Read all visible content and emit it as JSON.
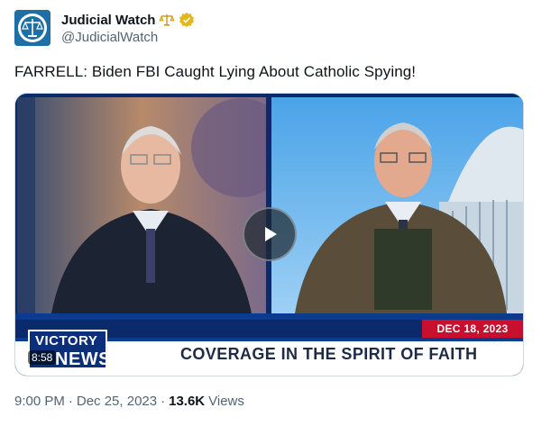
{
  "author": {
    "display_name": "Judicial Watch",
    "handle": "@JudicialWatch",
    "avatar_icon": "scales-of-justice-seal-icon",
    "name_emoji_icon": "scales-icon",
    "verified_badge": "gold-verified-badge-icon",
    "verified_color": "#e2b719"
  },
  "tweet": {
    "text": "FARRELL: Biden FBI Caught Lying About Catholic Spying!"
  },
  "video": {
    "duration": "8:58",
    "play_icon": "play-icon",
    "overlay": {
      "date": "DEC 18, 2023",
      "headline": "COVERAGE IN THE SPIRIT OF FAITH",
      "logo_top": "VICTORY",
      "logo_bottom": "NEWS"
    }
  },
  "meta": {
    "time": "9:00 PM",
    "date": "Dec 25, 2023",
    "separator": "·",
    "views_count": "13.6K",
    "views_label": "Views"
  },
  "colors": {
    "text_primary": "#0f1419",
    "text_secondary": "#536471",
    "border": "#cfd9de",
    "news_red": "#c8102e",
    "news_blue": "#0b3a8e"
  }
}
